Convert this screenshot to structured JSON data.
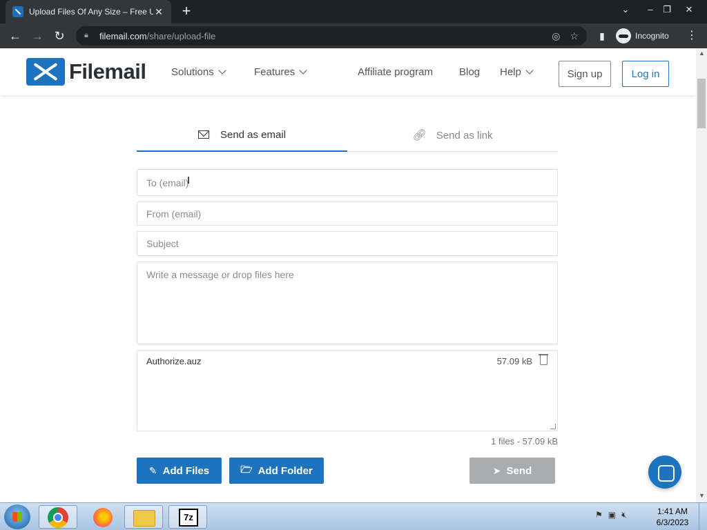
{
  "browser": {
    "tab_title": "Upload Files Of Any Size – Free U",
    "tab_close": "✕",
    "new_tab": "+",
    "url_host": "filemail.com",
    "url_path": "/share/upload-file",
    "profile_label": "Incognito"
  },
  "site": {
    "logo_text": "Filemail",
    "nav": {
      "solutions": "Solutions",
      "features": "Features",
      "affiliate": "Affiliate program",
      "blog": "Blog",
      "help": "Help"
    },
    "signup": "Sign up",
    "login": "Log in"
  },
  "form": {
    "tabs": {
      "email": "Send as email",
      "link": "Send as link"
    },
    "to_placeholder": "To (email)",
    "from_placeholder": "From (email)",
    "subject_placeholder": "Subject",
    "message_placeholder": "Write a message or drop files here",
    "files": [
      {
        "name": "Authorize.auz",
        "size": "57.09 kB"
      }
    ],
    "summary": "1 files - 57.09 kB",
    "add_files": "Add Files",
    "add_folder": "Add Folder",
    "send": "Send"
  },
  "taskbar": {
    "time": "1:41 AM",
    "date": "6/3/2023",
    "sevenzip": "7z"
  },
  "colors": {
    "accent": "#1e73be",
    "send_disabled": "#a9acae"
  }
}
